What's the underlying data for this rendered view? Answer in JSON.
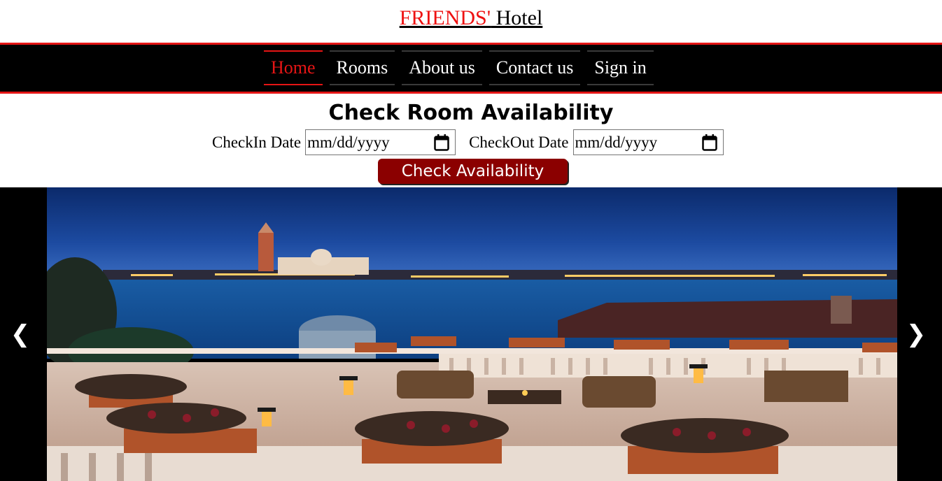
{
  "header": {
    "brand_part1": "FRIENDS'",
    "brand_part2": " Hotel"
  },
  "nav": {
    "items": [
      {
        "label": "Home",
        "active": true
      },
      {
        "label": "Rooms"
      },
      {
        "label": "About us"
      },
      {
        "label": "Contact us"
      },
      {
        "label": "Sign in"
      }
    ]
  },
  "availability": {
    "title": "Check Room Availability",
    "checkin_label": "CheckIn Date",
    "checkin_placeholder": "mm/dd/yyyy",
    "checkout_label": "CheckOut Date",
    "checkout_placeholder": "mm/dd/yyyy",
    "button_label": "Check Availability"
  },
  "carousel": {
    "prev_glyph": "❮",
    "next_glyph": "❯"
  },
  "colors": {
    "accent_red": "#e51515",
    "button_dark_red": "#8b0000",
    "nav_background": "#000000"
  }
}
